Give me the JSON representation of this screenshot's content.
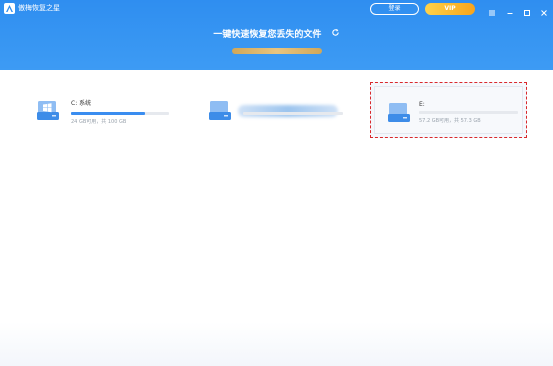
{
  "app": {
    "title": "傲梅恢复之星"
  },
  "header": {
    "login_label": "登录",
    "vip_label": "VIP",
    "hero_title": "一键快速恢复您丢失的文件"
  },
  "drives": [
    {
      "label": "C: 系统",
      "info": "24 GB可用，共 100 GB",
      "used_fraction": 0.76,
      "bar_color": "#3a8df0"
    },
    {
      "label": "",
      "info": "",
      "used_fraction": 0
    },
    {
      "label": "E:",
      "info": "57.2 GB可用，共 57.3 GB",
      "used_fraction": 0.0,
      "bar_color": "#3a8df0",
      "highlighted": true
    }
  ],
  "colors": {
    "accent": "#2f8ef0",
    "vip": "#f7a41b",
    "highlight": "#d9282c"
  },
  "icons": [
    "app-logo-icon",
    "menu-icon",
    "minimize-icon",
    "maximize-icon",
    "close-icon",
    "refresh-icon",
    "drive-icon"
  ]
}
